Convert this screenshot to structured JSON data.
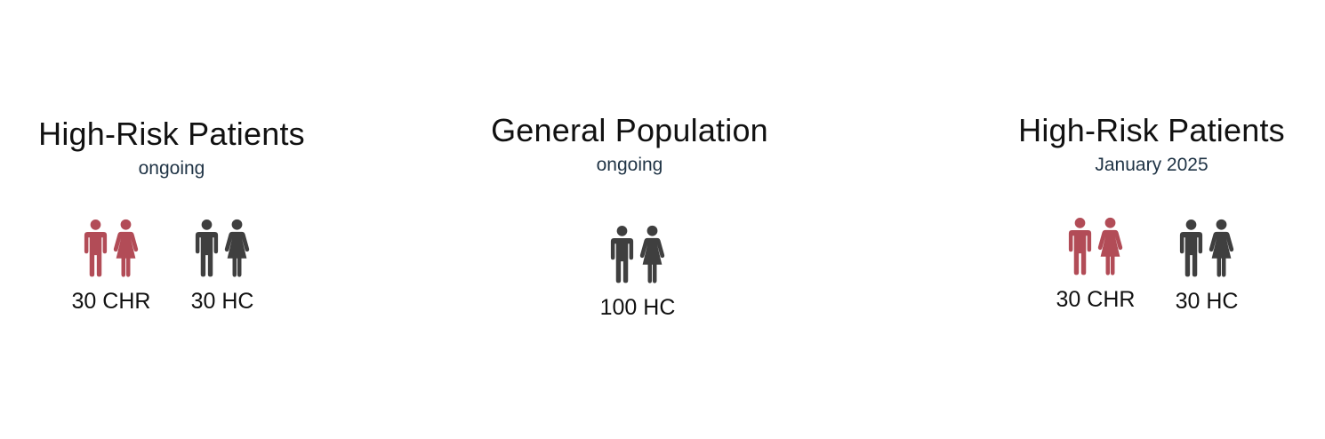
{
  "colors": {
    "risk": "#b24c57",
    "control": "#3f3f3f",
    "subtitle": "#1f3345"
  },
  "panels": [
    {
      "title": "High-Risk Patients",
      "subtitle": "ongoing",
      "groups": [
        {
          "label": "30 CHR",
          "icon": "male-female-icon",
          "color": "risk"
        },
        {
          "label": "30 HC",
          "icon": "male-female-icon",
          "color": "control"
        }
      ]
    },
    {
      "title": "General Population",
      "subtitle": "ongoing",
      "groups": [
        {
          "label": "100 HC",
          "icon": "male-female-icon",
          "color": "control"
        }
      ]
    },
    {
      "title": "High-Risk Patients",
      "subtitle": "January 2025",
      "groups": [
        {
          "label": "30 CHR",
          "icon": "male-female-icon",
          "color": "risk"
        },
        {
          "label": "30 HC",
          "icon": "male-female-icon",
          "color": "control"
        }
      ]
    }
  ]
}
